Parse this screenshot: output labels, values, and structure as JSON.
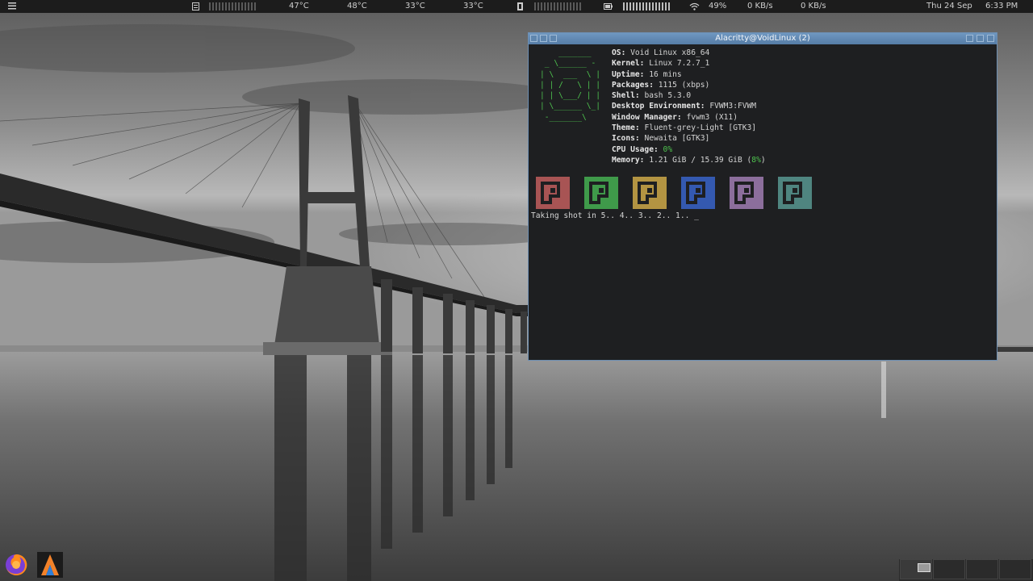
{
  "topbar": {
    "temps": [
      "47°C",
      "48°C",
      "33°C",
      "33°C"
    ],
    "wifi_signal": "49%",
    "net_down": "0 KB/s",
    "net_up": "0 KB/s",
    "date": "Thu 24 Sep",
    "time": "6:33 PM",
    "icons": [
      "menu-icon",
      "cpu-icon",
      "memory-icon",
      "battery-icon",
      "wifi-icon"
    ]
  },
  "terminal": {
    "title": "Alacritty@VoidLinux (2)",
    "ascii_logo": "    _______\n _ \\______ -\n| \\  ___  \\ |\n| | /   \\ | |\n| | \\___/ | |\n| \\______ \\_|\n -_______\\",
    "info": [
      {
        "key": "OS",
        "value": "Void Linux x86_64"
      },
      {
        "key": "Kernel",
        "value": "Linux 7.2.7_1"
      },
      {
        "key": "Uptime",
        "value": "16 mins"
      },
      {
        "key": "Packages",
        "value": "1115 (xbps)"
      },
      {
        "key": "Shell",
        "value": "bash 5.3.0"
      },
      {
        "key": "Desktop Environment",
        "value": "FVWM3:FVWM"
      },
      {
        "key": "Window Manager",
        "value": "fvwm3 (X11)"
      },
      {
        "key": "Theme",
        "value": "Fluent-grey-Light [GTK3]"
      },
      {
        "key": "Icons",
        "value": "Newaita [GTK3]"
      }
    ],
    "cpu": {
      "key": "CPU Usage",
      "value": "0%"
    },
    "memory": {
      "key": "Memory",
      "value_before": "1.21 GiB / 15.39 GiB (",
      "percent": "8%",
      "value_after": ")"
    },
    "swatch_colors": [
      "#a85454",
      "#3f9a4a",
      "#b39442",
      "#3459b0",
      "#8c6e9c",
      "#4f8580"
    ],
    "prompt_line": "Taking shot in 5.. 4.. 3.. 2.. 1.. _"
  },
  "dock": {
    "apps": [
      {
        "name": "firefox-icon"
      },
      {
        "name": "alacritty-icon"
      }
    ],
    "desks": 4
  }
}
